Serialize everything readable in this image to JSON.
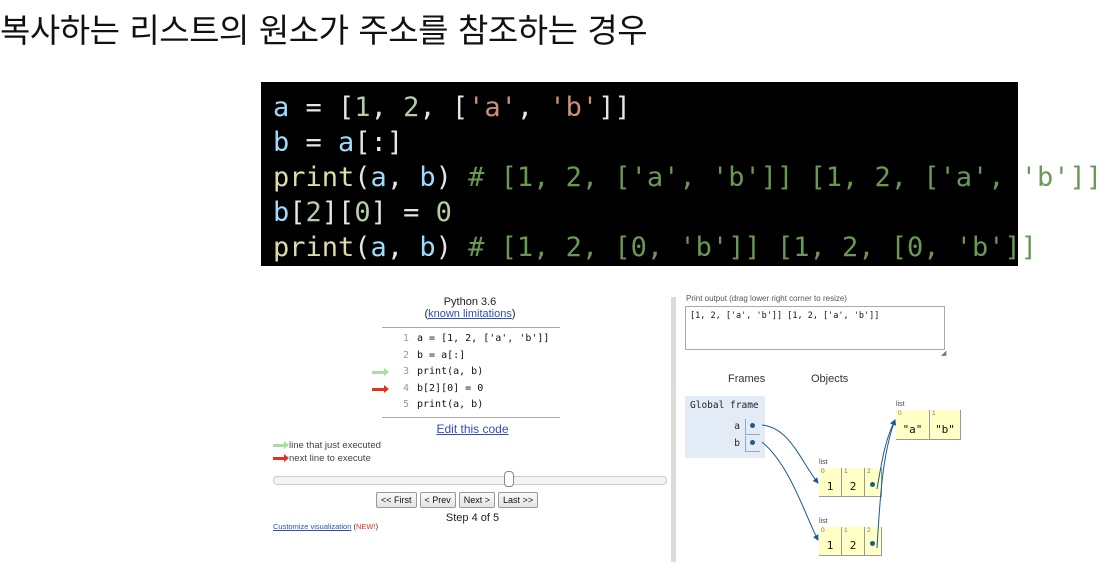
{
  "heading": "복사하는 리스트의 원소가 주소를 참조하는 경우",
  "code_block": {
    "lines": [
      [
        {
          "t": "a",
          "c": "var"
        },
        {
          "t": " = [",
          "c": "punct"
        },
        {
          "t": "1",
          "c": "num"
        },
        {
          "t": ", ",
          "c": "punct"
        },
        {
          "t": "2",
          "c": "num"
        },
        {
          "t": ", [",
          "c": "punct"
        },
        {
          "t": "'a'",
          "c": "str"
        },
        {
          "t": ", ",
          "c": "punct"
        },
        {
          "t": "'b'",
          "c": "str"
        },
        {
          "t": "]]",
          "c": "punct"
        }
      ],
      [
        {
          "t": "b",
          "c": "var"
        },
        {
          "t": " = ",
          "c": "punct"
        },
        {
          "t": "a",
          "c": "var"
        },
        {
          "t": "[:]",
          "c": "punct"
        }
      ],
      [
        {
          "t": "print",
          "c": "fn"
        },
        {
          "t": "(",
          "c": "punct"
        },
        {
          "t": "a",
          "c": "var"
        },
        {
          "t": ", ",
          "c": "punct"
        },
        {
          "t": "b",
          "c": "var"
        },
        {
          "t": ") ",
          "c": "punct"
        },
        {
          "t": "# [1, 2, ['a', 'b']] [1, 2, ['a', 'b']]",
          "c": "cmt"
        }
      ],
      [
        {
          "t": "b",
          "c": "var"
        },
        {
          "t": "[",
          "c": "punct"
        },
        {
          "t": "2",
          "c": "num"
        },
        {
          "t": "][",
          "c": "punct"
        },
        {
          "t": "0",
          "c": "num"
        },
        {
          "t": "] = ",
          "c": "punct"
        },
        {
          "t": "0",
          "c": "num"
        }
      ],
      [
        {
          "t": "print",
          "c": "fn"
        },
        {
          "t": "(",
          "c": "punct"
        },
        {
          "t": "a",
          "c": "var"
        },
        {
          "t": ", ",
          "c": "punct"
        },
        {
          "t": "b",
          "c": "var"
        },
        {
          "t": ") ",
          "c": "punct"
        },
        {
          "t": "# [1, 2, [0, 'b']] [1, 2, [0, 'b']]",
          "c": "cmt"
        }
      ]
    ]
  },
  "tutor": {
    "python_version": "Python 3.6",
    "limits_open": "(",
    "limits_link": "known limitations",
    "limits_close": ")",
    "code_lines": [
      {
        "num": "1",
        "text": "a = [1, 2, ['a', 'b']]",
        "marker": ""
      },
      {
        "num": "2",
        "text": "b = a[:]",
        "marker": ""
      },
      {
        "num": "3",
        "text": "print(a, b)",
        "marker": "green"
      },
      {
        "num": "4",
        "text": "b[2][0] = 0",
        "marker": "red"
      },
      {
        "num": "5",
        "text": "print(a, b)",
        "marker": ""
      }
    ],
    "edit_link": "Edit this code",
    "legend_executed": "line that just executed",
    "legend_next": "next line to execute",
    "buttons": {
      "first": "<< First",
      "prev": "< Prev",
      "next": "Next >",
      "last": "Last >>"
    },
    "step_text": "Step 4 of 5",
    "customize_link": "Customize visualization",
    "customize_new": "NEW!",
    "slider_fraction": 0.6
  },
  "output": {
    "label": "Print output (drag lower right corner to resize)",
    "text": "[1, 2, ['a', 'b']] [1, 2, ['a', 'b']]"
  },
  "viz": {
    "frames_label": "Frames",
    "objects_label": "Objects",
    "global_frame": "Global frame",
    "vars": [
      "a",
      "b"
    ],
    "inner_list": {
      "type": "list",
      "indices": [
        "0",
        "1"
      ],
      "values": [
        "\"a\"",
        "\"b\""
      ]
    },
    "list_a": {
      "type": "list",
      "indices": [
        "0",
        "1",
        "2"
      ],
      "values": [
        "1",
        "2",
        ""
      ]
    },
    "list_b": {
      "type": "list",
      "indices": [
        "0",
        "1",
        "2"
      ],
      "values": [
        "1",
        "2",
        ""
      ]
    }
  },
  "colors": {
    "code_bg": "#000000",
    "pointer": "#1b5a8e",
    "list_cell": "#ffffc6",
    "frame_bg": "#e2ebf6",
    "red_arrow": "#e0341f",
    "green_arrow": "#a8e0a0"
  }
}
